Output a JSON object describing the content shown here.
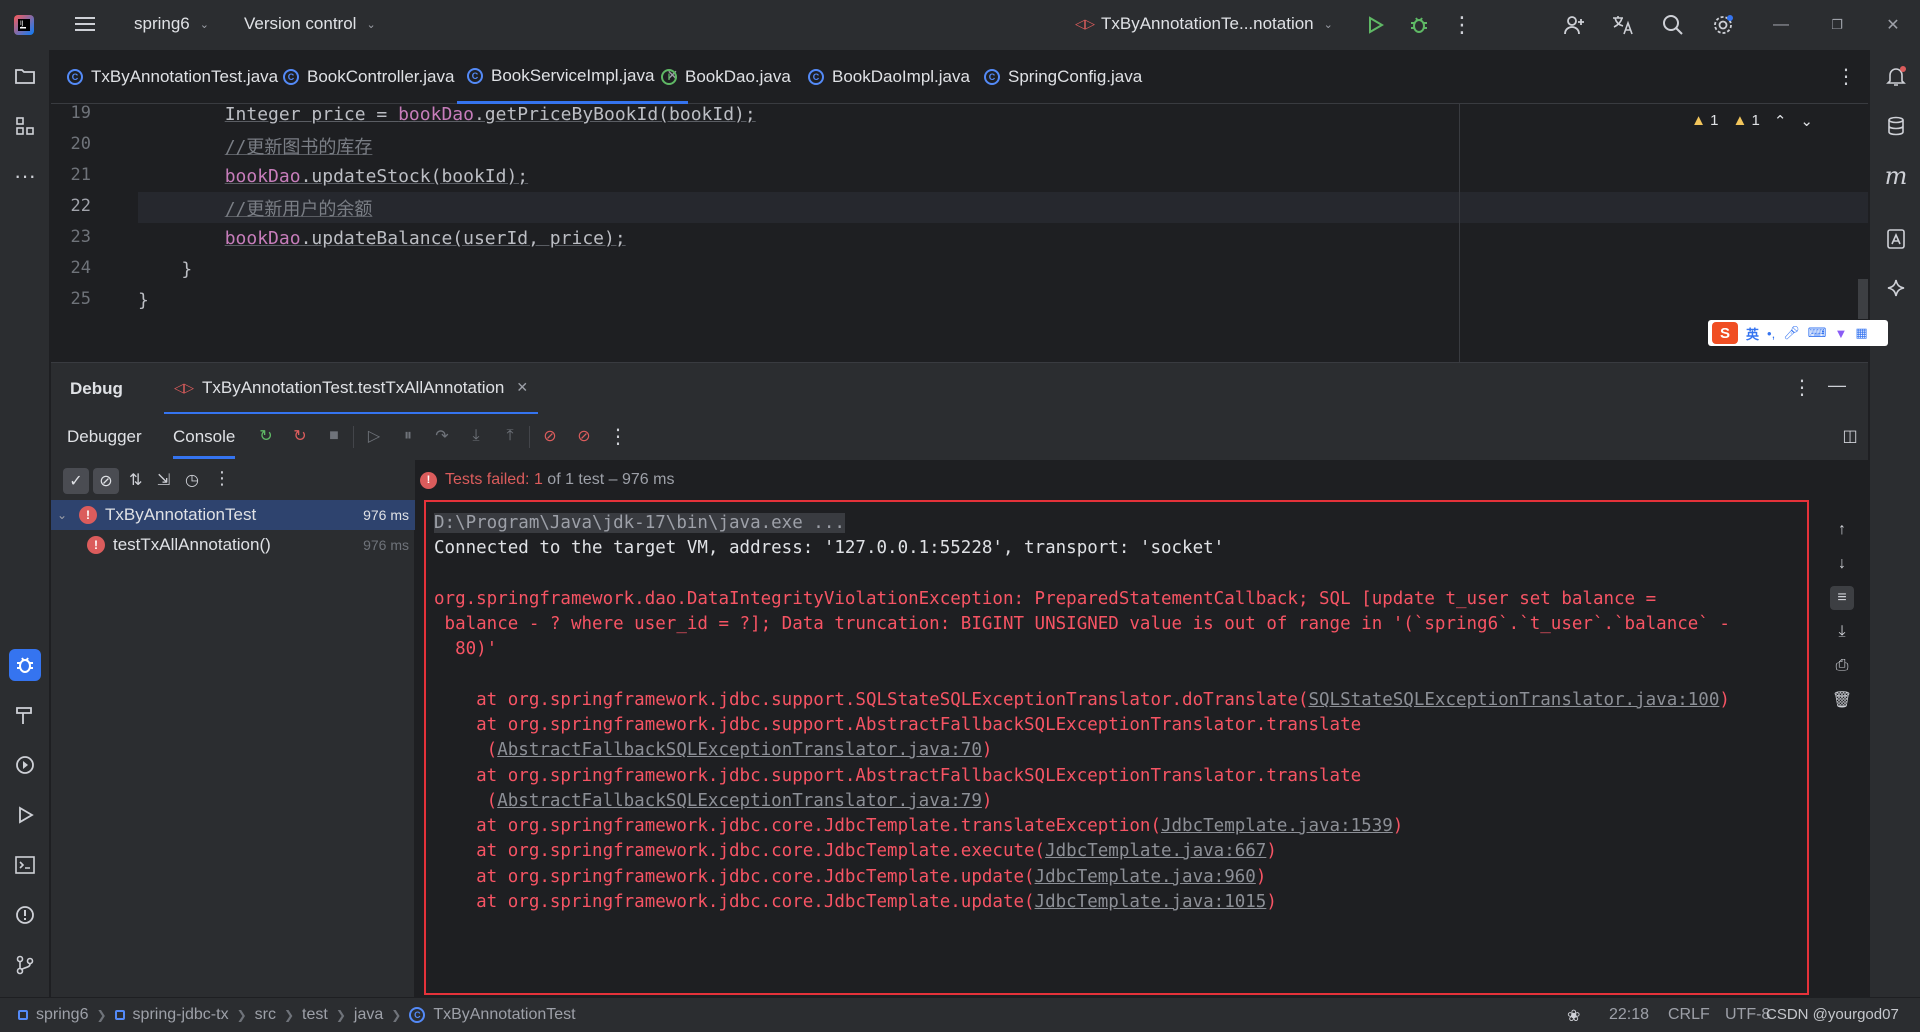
{
  "titlebar": {
    "project": "spring6",
    "vcs": "Version control",
    "run_config": "TxByAnnotationTe...notation"
  },
  "tabs": [
    {
      "label": "TxByAnnotationTest.java",
      "kind": "class"
    },
    {
      "label": "BookController.java",
      "kind": "class"
    },
    {
      "label": "BookServiceImpl.java",
      "kind": "class",
      "active": true
    },
    {
      "label": "BookDao.java",
      "kind": "interface"
    },
    {
      "label": "BookDaoImpl.java",
      "kind": "class"
    },
    {
      "label": "SpringConfig.java",
      "kind": "class"
    }
  ],
  "editor": {
    "warnings": {
      "count1": "1",
      "count2": "1"
    },
    "lines": [
      {
        "n": "19",
        "indent": "        ",
        "a": "Integer price = ",
        "b": "bookDao",
        "c": ".getPriceByBookId(bookId);"
      },
      {
        "n": "20",
        "indent": "        ",
        "comment": "//更新图书的库存"
      },
      {
        "n": "21",
        "indent": "        ",
        "a": "",
        "b": "bookDao",
        "c": ".updateStock(bookId);"
      },
      {
        "n": "22",
        "indent": "        ",
        "comment": "//更新用户的余额"
      },
      {
        "n": "23",
        "indent": "        ",
        "a": "",
        "b": "bookDao",
        "c": ".updateBalance(userId, price);"
      },
      {
        "n": "24",
        "indent": "    ",
        "a": "}",
        "b": "",
        "c": ""
      },
      {
        "n": "25",
        "indent": "",
        "a": "}",
        "b": "",
        "c": ""
      }
    ]
  },
  "debug": {
    "title": "Debug",
    "session_tab": "TxByAnnotationTest.testTxAllAnnotation",
    "debugger_label": "Debugger",
    "console_label": "Console"
  },
  "tests": {
    "status_failed": "Tests failed: ",
    "status_count": "1",
    "status_rest": " of 1 test – 976 ms",
    "root": {
      "name": "TxByAnnotationTest",
      "time": "976 ms"
    },
    "child": {
      "name": "testTxAllAnnotation()",
      "time": "976 ms"
    }
  },
  "console": {
    "l1": "D:\\Program\\Java\\jdk-17\\bin\\java.exe ...",
    "l2": "Connected to the target VM, address: '127.0.0.1:55228', transport: 'socket'",
    "l3": "org.springframework.dao.DataIntegrityViolationException: PreparedStatementCallback; SQL [update t_user set balance =",
    "l4": " balance - ? where user_id = ?]; Data truncation: BIGINT UNSIGNED value is out of range in '(`spring6`.`t_user`.`balance` -",
    "l5": "  80)'",
    "s1a": "    at org.springframework.jdbc.support.SQLStateSQLExceptionTranslator.doTranslate(",
    "s1b": "SQLStateSQLExceptionTranslator.java:100",
    "s2a": "    at org.springframework.jdbc.support.AbstractFallbackSQLExceptionTranslator.translate",
    "s2b": "AbstractFallbackSQLExceptionTranslator.java:70",
    "s3a": "    at org.springframework.jdbc.support.AbstractFallbackSQLExceptionTranslator.translate",
    "s3b": "AbstractFallbackSQLExceptionTranslator.java:79",
    "s4a": "    at org.springframework.jdbc.core.JdbcTemplate.translateException(",
    "s4b": "JdbcTemplate.java:1539",
    "s5a": "    at org.springframework.jdbc.core.JdbcTemplate.execute(",
    "s5b": "JdbcTemplate.java:667",
    "s6a": "    at org.springframework.jdbc.core.JdbcTemplate.update(",
    "s6b": "JdbcTemplate.java:960",
    "s7a": "    at org.springframework.jdbc.core.JdbcTemplate.update(",
    "s7b": "JdbcTemplate.java:1015"
  },
  "statusbar": {
    "crumbs": [
      "spring6",
      "spring-jdbc-tx",
      "src",
      "test",
      "java",
      "TxByAnnotationTest"
    ],
    "position": "22:18",
    "line_sep": "CRLF",
    "encoding": "UTF-8",
    "watermark": "CSDN @yourgod07"
  },
  "colors": {
    "accent": "#3574f0",
    "error": "#db5c5c",
    "frame": "#e5323a"
  }
}
